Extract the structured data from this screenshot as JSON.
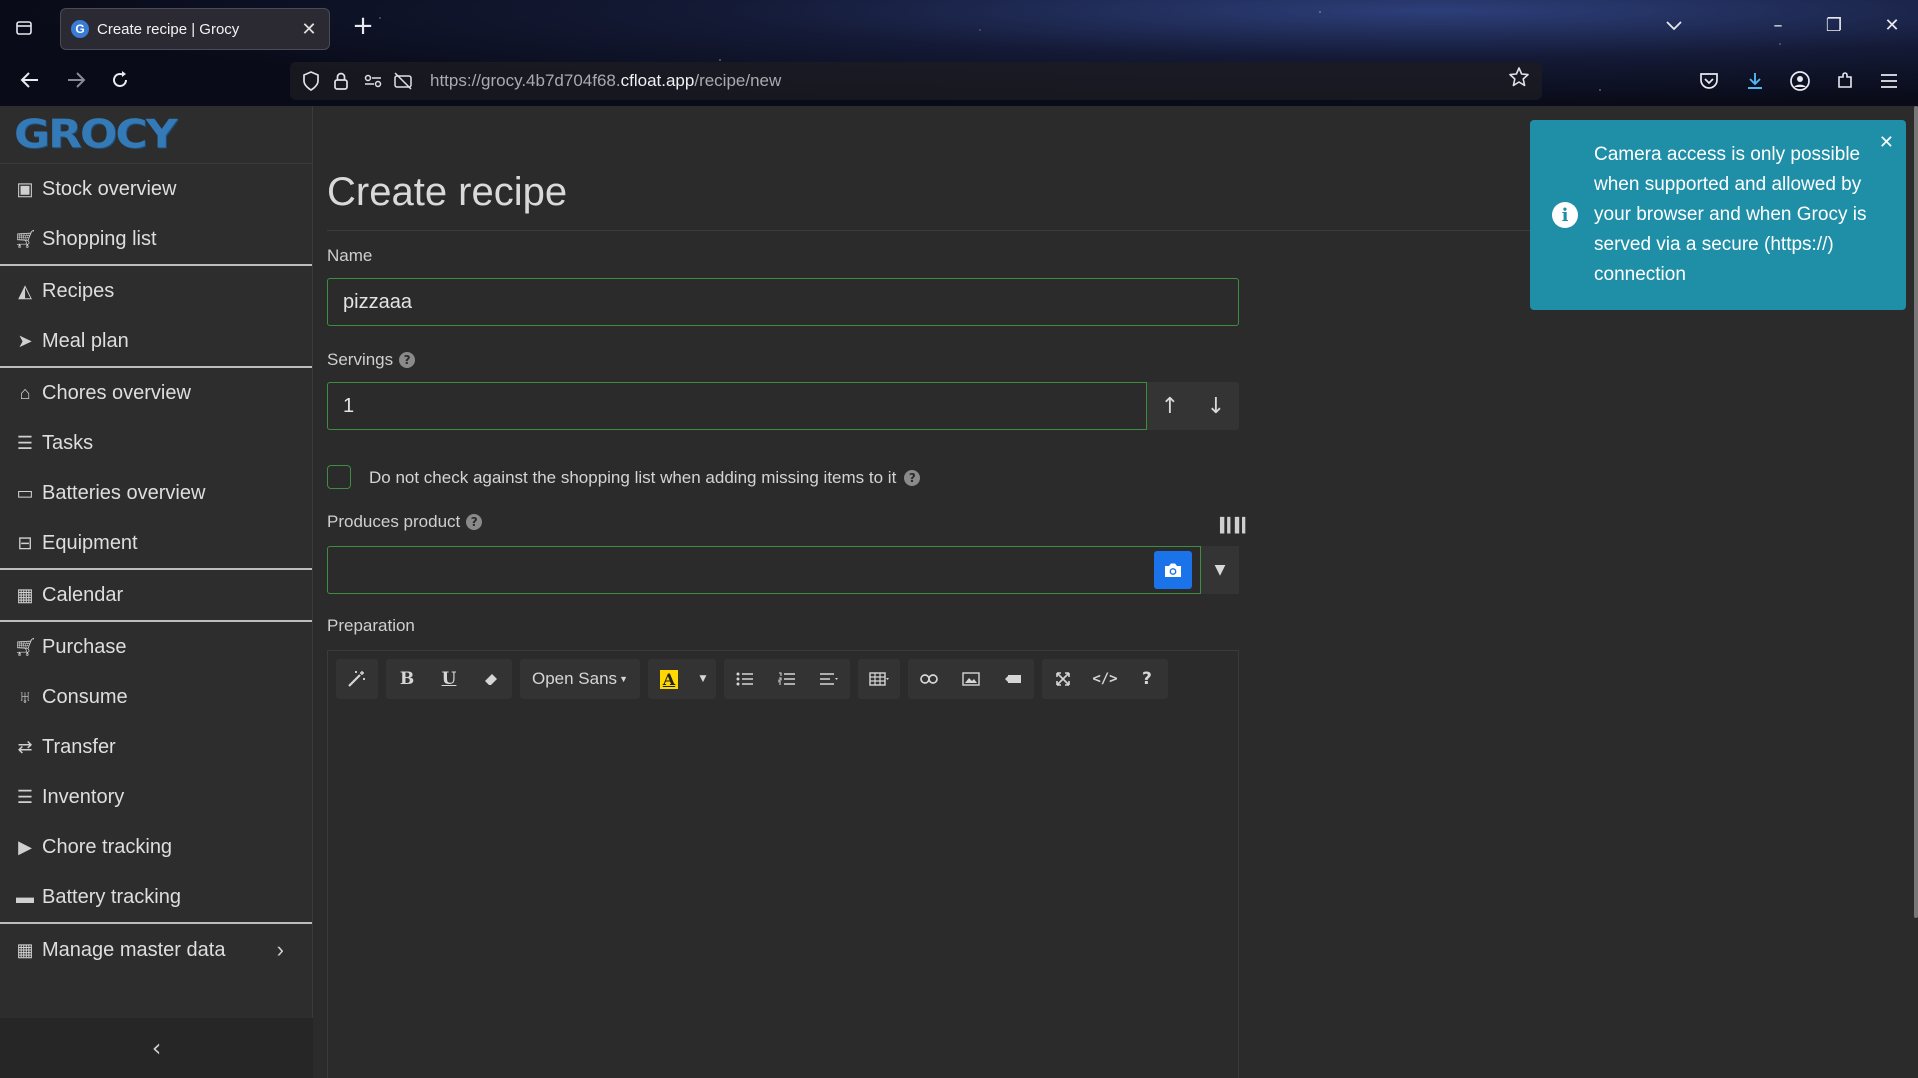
{
  "browser": {
    "tab_title": "Create recipe | Grocy",
    "tab_favicon_letter": "G",
    "url_prefix": "https://grocy.4b7d704f68.",
    "url_domain": "cfloat.app",
    "url_path": "/recipe/new"
  },
  "app": {
    "logo": "GROCY",
    "sidebar": {
      "groups": [
        [
          {
            "label": "Stock overview",
            "icon": "box-icon"
          },
          {
            "label": "Shopping list",
            "icon": "cart-icon"
          }
        ],
        [
          {
            "label": "Recipes",
            "icon": "pizza-icon"
          },
          {
            "label": "Meal plan",
            "icon": "paper-plane-icon"
          }
        ],
        [
          {
            "label": "Chores overview",
            "icon": "home-icon"
          },
          {
            "label": "Tasks",
            "icon": "tasks-icon"
          },
          {
            "label": "Batteries overview",
            "icon": "battery-icon"
          },
          {
            "label": "Equipment",
            "icon": "toolbox-icon"
          }
        ],
        [
          {
            "label": "Calendar",
            "icon": "calendar-icon"
          }
        ],
        [
          {
            "label": "Purchase",
            "icon": "cart-plus-icon"
          },
          {
            "label": "Consume",
            "icon": "utensils-icon"
          },
          {
            "label": "Transfer",
            "icon": "exchange-icon"
          },
          {
            "label": "Inventory",
            "icon": "list-icon"
          },
          {
            "label": "Chore tracking",
            "icon": "play-icon"
          },
          {
            "label": "Battery tracking",
            "icon": "car-battery-icon"
          }
        ],
        [
          {
            "label": "Manage master data",
            "icon": "table-icon"
          }
        ]
      ]
    }
  },
  "form": {
    "title": "Create recipe",
    "name_label": "Name",
    "name_value": "pizzaaa",
    "servings_label": "Servings",
    "servings_value": "1",
    "checkbox_label": "Do not check against the shopping list when adding missing items to it",
    "produces_label": "Produces product",
    "produces_value": "",
    "preparation_label": "Preparation"
  },
  "editor": {
    "font_name": "Open Sans",
    "highlight_letter": "A",
    "tools": [
      "magic-icon",
      "bold-icon",
      "underline-icon",
      "eraser-icon",
      "font-select",
      "highlight-color",
      "ul-list-icon",
      "ol-list-icon",
      "align-icon",
      "table-icon",
      "link-icon",
      "image-icon",
      "video-icon",
      "fullscreen-icon",
      "code-icon",
      "help-icon"
    ]
  },
  "toast": {
    "message": "Camera access is only possible when supported and allowed by your browser and when Grocy is served via a secure (https://) connection",
    "color": "#1f8fa8"
  },
  "colors": {
    "accent": "#337ab7",
    "valid_border": "#3e8e41",
    "camera_button": "#1a73e8"
  }
}
